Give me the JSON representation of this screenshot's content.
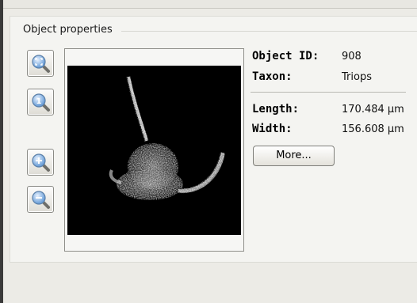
{
  "panel": {
    "title": "Object properties"
  },
  "zoom_buttons": [
    {
      "name": "zoom-fit",
      "icon": "zoom-fit-icon"
    },
    {
      "name": "zoom-actual",
      "icon": "zoom-actual-size-icon"
    },
    {
      "name": "zoom-in",
      "icon": "zoom-in-icon"
    },
    {
      "name": "zoom-out",
      "icon": "zoom-out-icon"
    }
  ],
  "image": {
    "background": "#000000"
  },
  "properties": {
    "object_id": {
      "label": "Object ID:",
      "value": "908"
    },
    "taxon": {
      "label": "Taxon:",
      "value": "Triops"
    },
    "length": {
      "label": "Length:",
      "value": "170.484 µm"
    },
    "width": {
      "label": "Width:",
      "value": "156.608 µm"
    }
  },
  "more_button": {
    "label": "More..."
  },
  "colors": {
    "window_bg": "#ecebe6",
    "panel_bg": "#f4f4f1",
    "button_icon_blue": "#4f86c6"
  }
}
